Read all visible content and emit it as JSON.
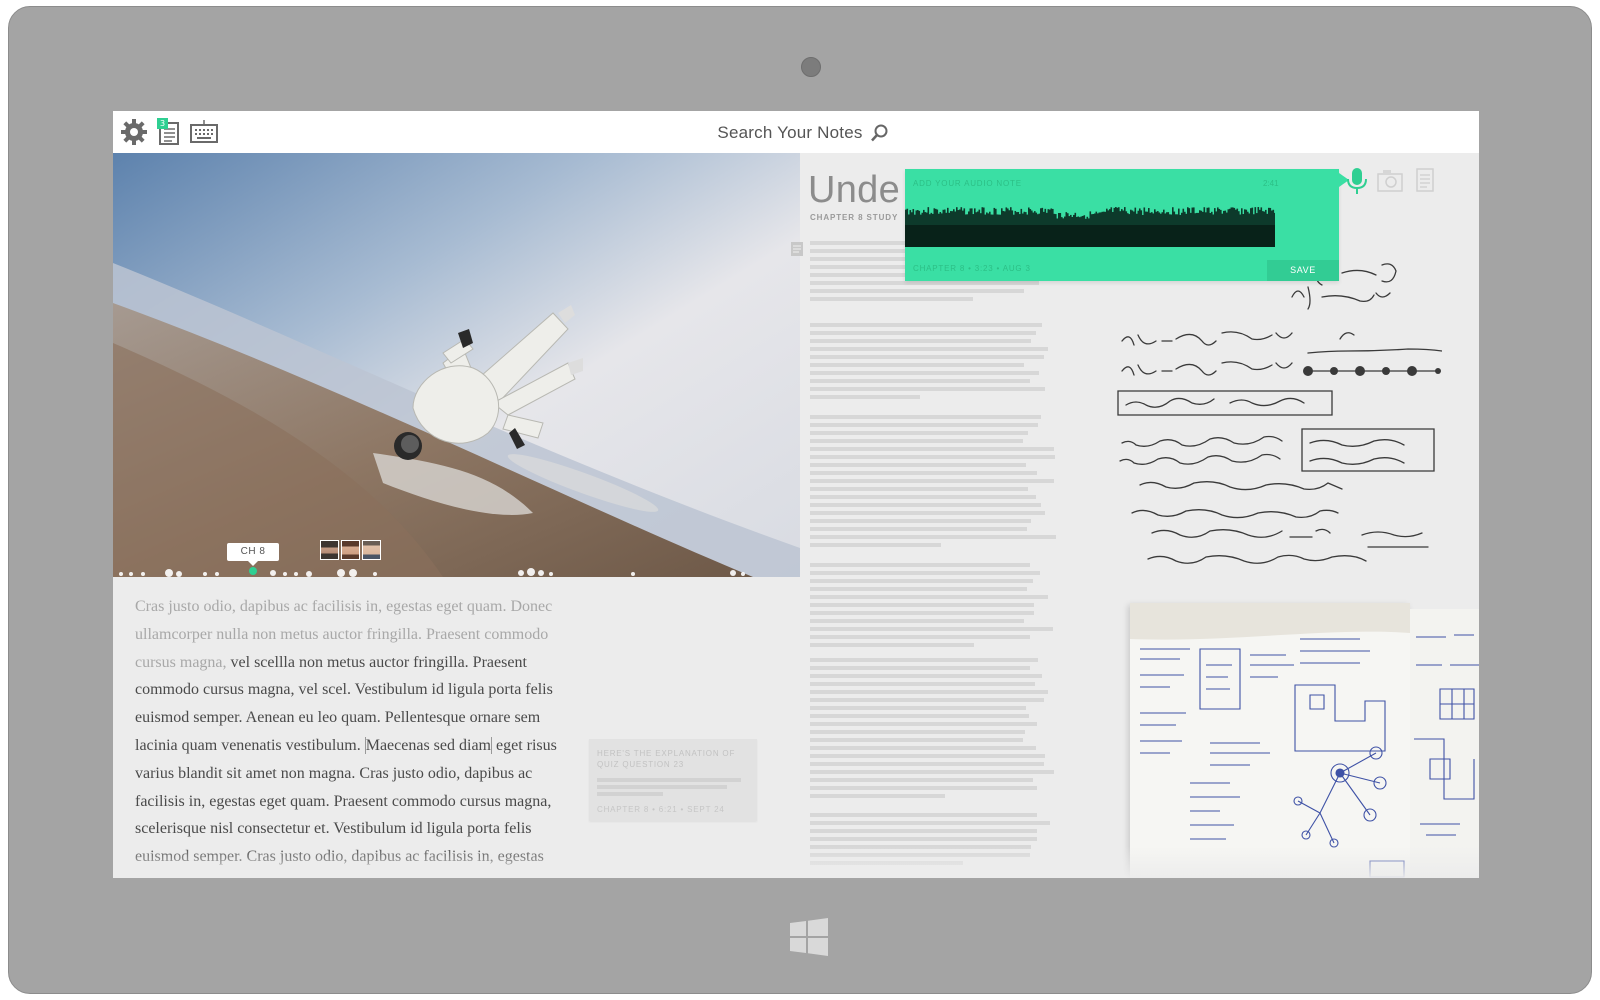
{
  "topbar": {
    "search_placeholder": "Search Your Notes",
    "notes_badge": "3",
    "icons": [
      "gear-icon",
      "notes-icon",
      "keyboard-icon",
      "search-icon"
    ]
  },
  "left": {
    "chapter_tag": "CH 8",
    "reading": {
      "faded": "Cras justo odio, dapibus ac facilisis in, egestas eget quam. Donec ullamcorper nulla non metus auctor fringilla. Praesent commodo cursus magna,",
      "before_highlight": " vel scellla non metus auctor fringilla. Praesent commodo cursus magna, vel scel. Vestibulum id ligula porta felis euismod semper. Aenean eu leo quam. Pellentesque ornare sem lacinia quam venenatis vestibulum.",
      "highlight": "Maecenas sed diam",
      "after_highlight": "eget risus varius blandit sit amet non magna. Cras justo odio, dapibus ac facilisis in, egestas eget quam. Praesent commodo cursus magna, scelerisque nisl consectetur et. Vestibulum id ligula porta felis euismod semper. Cras justo odio, dapibus ac facilisis in, egestas"
    },
    "note_card": {
      "title": "HERE'S THE EXPLANATION OF QUIZ QUESTION 23",
      "meta": "CHAPTER 8  •  6:21  •  SEPT 24"
    }
  },
  "right": {
    "doc_title": "Unde",
    "doc_subtitle": "CHAPTER 8 STUDY",
    "audio": {
      "title": "ADD YOUR AUDIO NOTE",
      "duration": "2:41",
      "meta": "CHAPTER 8  •  3:23  •  AUG 3",
      "save_label": "SAVE"
    },
    "tools": [
      "microphone-icon",
      "camera-icon",
      "text-note-icon"
    ]
  },
  "colors": {
    "accent": "#3adfa4",
    "accent_dark": "#2fcf92",
    "frame": "#a4a4a4",
    "screen_bg": "#ececec"
  }
}
